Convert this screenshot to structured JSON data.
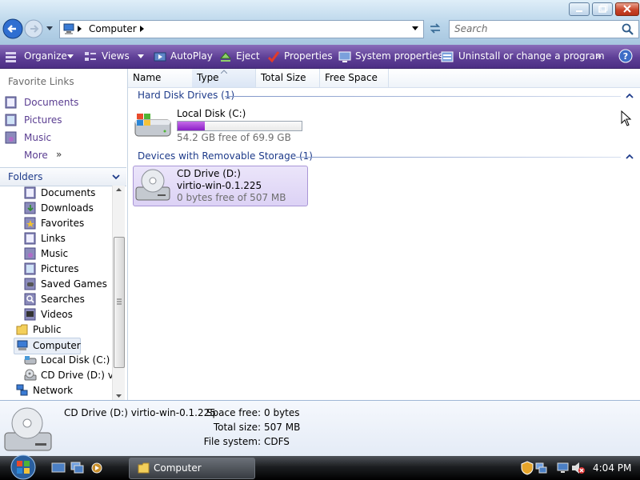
{
  "window": {
    "address": {
      "crumb": "Computer"
    },
    "search": {
      "placeholder": "Search"
    }
  },
  "toolbar": {
    "organize": "Organize",
    "views": "Views",
    "autoplay": "AutoPlay",
    "eject": "Eject",
    "properties": "Properties",
    "system_properties": "System properties",
    "uninstall": "Uninstall or change a program"
  },
  "left": {
    "favorite_links_title": "Favorite Links",
    "favorites": [
      "Documents",
      "Pictures",
      "Music"
    ],
    "more": "More",
    "folders_title": "Folders",
    "tree": [
      "Documents",
      "Downloads",
      "Favorites",
      "Links",
      "Music",
      "Pictures",
      "Saved Games",
      "Searches",
      "Videos",
      "Public",
      "Computer",
      "Local Disk (C:)",
      "CD Drive (D:) virt",
      "Network"
    ]
  },
  "columns": [
    "Name",
    "Type",
    "Total Size",
    "Free Space"
  ],
  "groups": {
    "hdd": {
      "title": "Hard Disk Drives (1)",
      "drive": {
        "name": "Local Disk (C:)",
        "free_text": "54.2 GB free of 69.9 GB",
        "used_fraction": 0.22
      }
    },
    "removable": {
      "title": "Devices with Removable Storage (1)",
      "drive": {
        "name": "CD Drive (D:)",
        "label": "virtio-win-0.1.225",
        "free_text": "0 bytes free of 507 MB"
      }
    }
  },
  "details": {
    "title": "CD Drive (D:) virtio-win-0.1.225",
    "space_free_label": "Space free:",
    "space_free": "0 bytes",
    "total_size_label": "Total size:",
    "total_size": "507 MB",
    "file_system_label": "File system:",
    "file_system": "CDFS"
  },
  "taskbar": {
    "task": "Computer",
    "clock": "4:04 PM"
  },
  "colors": {
    "accent": "#5e3f96",
    "link": "#5a3d91",
    "group": "#1e3b8a",
    "progress": "#9b2fd6"
  }
}
